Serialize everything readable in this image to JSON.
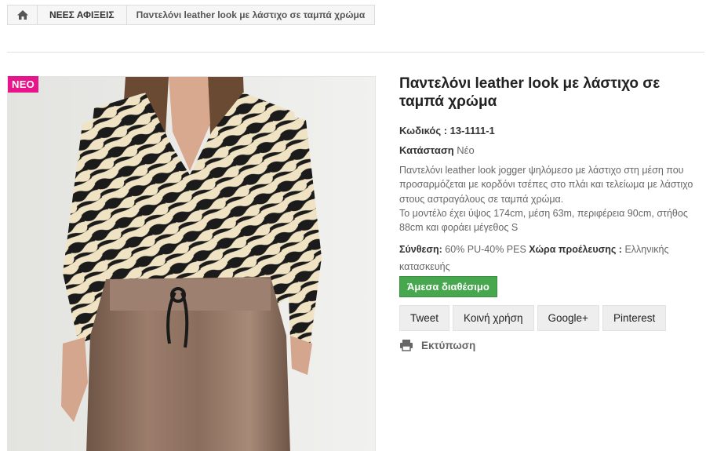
{
  "breadcrumb": {
    "home_icon": "home-icon",
    "category": "ΝΕΕΣ ΑΦΙΞΕΙΣ",
    "current": "Παντελόνι leather look με λάστιχο σε ταμπά χρώμα"
  },
  "product": {
    "badge": "ΝΕΟ",
    "title": "Παντελόνι leather look με λάστιχο σε ταμπά χρώμα",
    "reference": "Κωδικός : 13-1111-1",
    "condition_label": "Κατάσταση",
    "condition_value": "Νέο",
    "description_1": "Παντελόνι leather look jogger ψηλόμεσο με λάστιχο στη μέση που προσαρμόζεται με κορδόνι τσέπες στο πλάι και τελείωμα με λάστιχο στους αστραγάλους σε ταμπά χρώμα.",
    "description_2": "Το μοντέλο έχει ύψος 174cm, μέση 63m, περιφέρεια 90cm, στήθος 88cm και φοράει μέγεθος S",
    "composition_label": "Σύνθεση:",
    "composition_value": "60% PU-40% PES",
    "origin_label": "Χώρα προέλευσης :",
    "origin_value": "Ελληνικής κατασκευής",
    "availability": "Άμεσα διαθέσιμο"
  },
  "social": {
    "tweet": "Tweet",
    "share": "Κοινή χρήση",
    "google": "Google+",
    "pinterest": "Pinterest"
  },
  "print": {
    "icon": "printer-icon",
    "label": "Εκτύπωση"
  },
  "colors": {
    "badge": "#e8158a",
    "availability": "#46a74e"
  }
}
